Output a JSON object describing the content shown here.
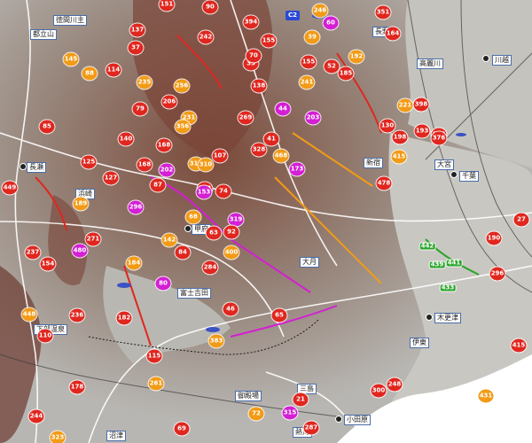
{
  "markers": [
    {
      "t": "151",
      "c": "r"
    },
    {
      "t": "90",
      "c": "r"
    },
    {
      "t": "394",
      "c": "r"
    },
    {
      "t": "246",
      "c": "o"
    },
    {
      "t": "351",
      "c": "r"
    },
    {
      "t": "155",
      "c": "r"
    },
    {
      "t": "39",
      "c": "o"
    },
    {
      "t": "60",
      "c": "m"
    },
    {
      "t": "164",
      "c": "r"
    },
    {
      "t": "137",
      "c": "r"
    },
    {
      "t": "37",
      "c": "r"
    },
    {
      "t": "242",
      "c": "r"
    },
    {
      "t": "35",
      "c": "r"
    },
    {
      "t": "155",
      "c": "r"
    },
    {
      "t": "185",
      "c": "r"
    },
    {
      "t": "70",
      "c": "r"
    },
    {
      "t": "52",
      "c": "r"
    },
    {
      "t": "192",
      "c": "o"
    },
    {
      "t": "145",
      "c": "o"
    },
    {
      "t": "114",
      "c": "r"
    },
    {
      "t": "88",
      "c": "o"
    },
    {
      "t": "235",
      "c": "o"
    },
    {
      "t": "256",
      "c": "o"
    },
    {
      "t": "138",
      "c": "r"
    },
    {
      "t": "241",
      "c": "o"
    },
    {
      "t": "85",
      "c": "r"
    },
    {
      "t": "79",
      "c": "r"
    },
    {
      "t": "206",
      "c": "r"
    },
    {
      "t": "231",
      "c": "o"
    },
    {
      "t": "44",
      "c": "m"
    },
    {
      "t": "140",
      "c": "r"
    },
    {
      "t": "356",
      "c": "o"
    },
    {
      "t": "269",
      "c": "r"
    },
    {
      "t": "203",
      "c": "m"
    },
    {
      "t": "41",
      "c": "r"
    },
    {
      "t": "168",
      "c": "r"
    },
    {
      "t": "318",
      "c": "o"
    },
    {
      "t": "107",
      "c": "r"
    },
    {
      "t": "328",
      "c": "r"
    },
    {
      "t": "468",
      "c": "o"
    },
    {
      "t": "125",
      "c": "r"
    },
    {
      "t": "449",
      "c": "r"
    },
    {
      "t": "127",
      "c": "r"
    },
    {
      "t": "168",
      "c": "r"
    },
    {
      "t": "202",
      "c": "m"
    },
    {
      "t": "310",
      "c": "o"
    },
    {
      "t": "173",
      "c": "m"
    },
    {
      "t": "87",
      "c": "r"
    },
    {
      "t": "153",
      "c": "r"
    },
    {
      "t": "74",
      "c": "r"
    },
    {
      "t": "189",
      "c": "o"
    },
    {
      "t": "296",
      "c": "m"
    },
    {
      "t": "68",
      "c": "o"
    },
    {
      "t": "319",
      "c": "m"
    },
    {
      "t": "63",
      "c": "r"
    },
    {
      "t": "92",
      "c": "r"
    },
    {
      "t": "271",
      "c": "r"
    },
    {
      "t": "480",
      "c": "m"
    },
    {
      "t": "142",
      "c": "o"
    },
    {
      "t": "153",
      "c": "m"
    },
    {
      "t": "237",
      "c": "r"
    },
    {
      "t": "84",
      "c": "r"
    },
    {
      "t": "154",
      "c": "r"
    },
    {
      "t": "184",
      "c": "o"
    },
    {
      "t": "284",
      "c": "r"
    },
    {
      "t": "400",
      "c": "o"
    },
    {
      "t": "80",
      "c": "m"
    },
    {
      "t": "182",
      "c": "r"
    },
    {
      "t": "448",
      "c": "o"
    },
    {
      "t": "236",
      "c": "r"
    },
    {
      "t": "46",
      "c": "r"
    },
    {
      "t": "65",
      "c": "r"
    },
    {
      "t": "110",
      "c": "r"
    },
    {
      "t": "383",
      "c": "o"
    },
    {
      "t": "115",
      "c": "r"
    },
    {
      "t": "178",
      "c": "r"
    },
    {
      "t": "261",
      "c": "o"
    },
    {
      "t": "244",
      "c": "r"
    },
    {
      "t": "323",
      "c": "o"
    },
    {
      "t": "69",
      "c": "r"
    },
    {
      "t": "72",
      "c": "o"
    },
    {
      "t": "315",
      "c": "m"
    },
    {
      "t": "21",
      "c": "r"
    },
    {
      "t": "287",
      "c": "r"
    },
    {
      "t": "300",
      "c": "r"
    },
    {
      "t": "248",
      "c": "r"
    },
    {
      "t": "415",
      "c": "r"
    },
    {
      "t": "431",
      "c": "o"
    },
    {
      "t": "27",
      "c": "r"
    },
    {
      "t": "190",
      "c": "r"
    },
    {
      "t": "296",
      "c": "r"
    },
    {
      "t": "442",
      "c": "g"
    },
    {
      "t": "441",
      "c": "g"
    },
    {
      "t": "433",
      "c": "g"
    },
    {
      "t": "439",
      "c": "g"
    },
    {
      "t": "376",
      "c": "r"
    },
    {
      "t": "221",
      "c": "o"
    },
    {
      "t": "398",
      "c": "r"
    },
    {
      "t": "376",
      "c": "r"
    },
    {
      "t": "478",
      "c": "r"
    },
    {
      "t": "193",
      "c": "r"
    },
    {
      "t": "198",
      "c": "r"
    },
    {
      "t": "130",
      "c": "r"
    },
    {
      "t": "415",
      "c": "o"
    }
  ],
  "stations": [
    "徳間川主",
    "都立山",
    "長野",
    "長瀬",
    "浜崎",
    "甲府",
    "富士吉田",
    "下部温泉",
    "御殿場",
    "伊東",
    "小田原",
    "熱海",
    "沼津",
    "三島",
    "大月",
    "高麗川",
    "川越",
    "大宮",
    "千葉",
    "木更津",
    "新宿"
  ],
  "badge": "C2"
}
